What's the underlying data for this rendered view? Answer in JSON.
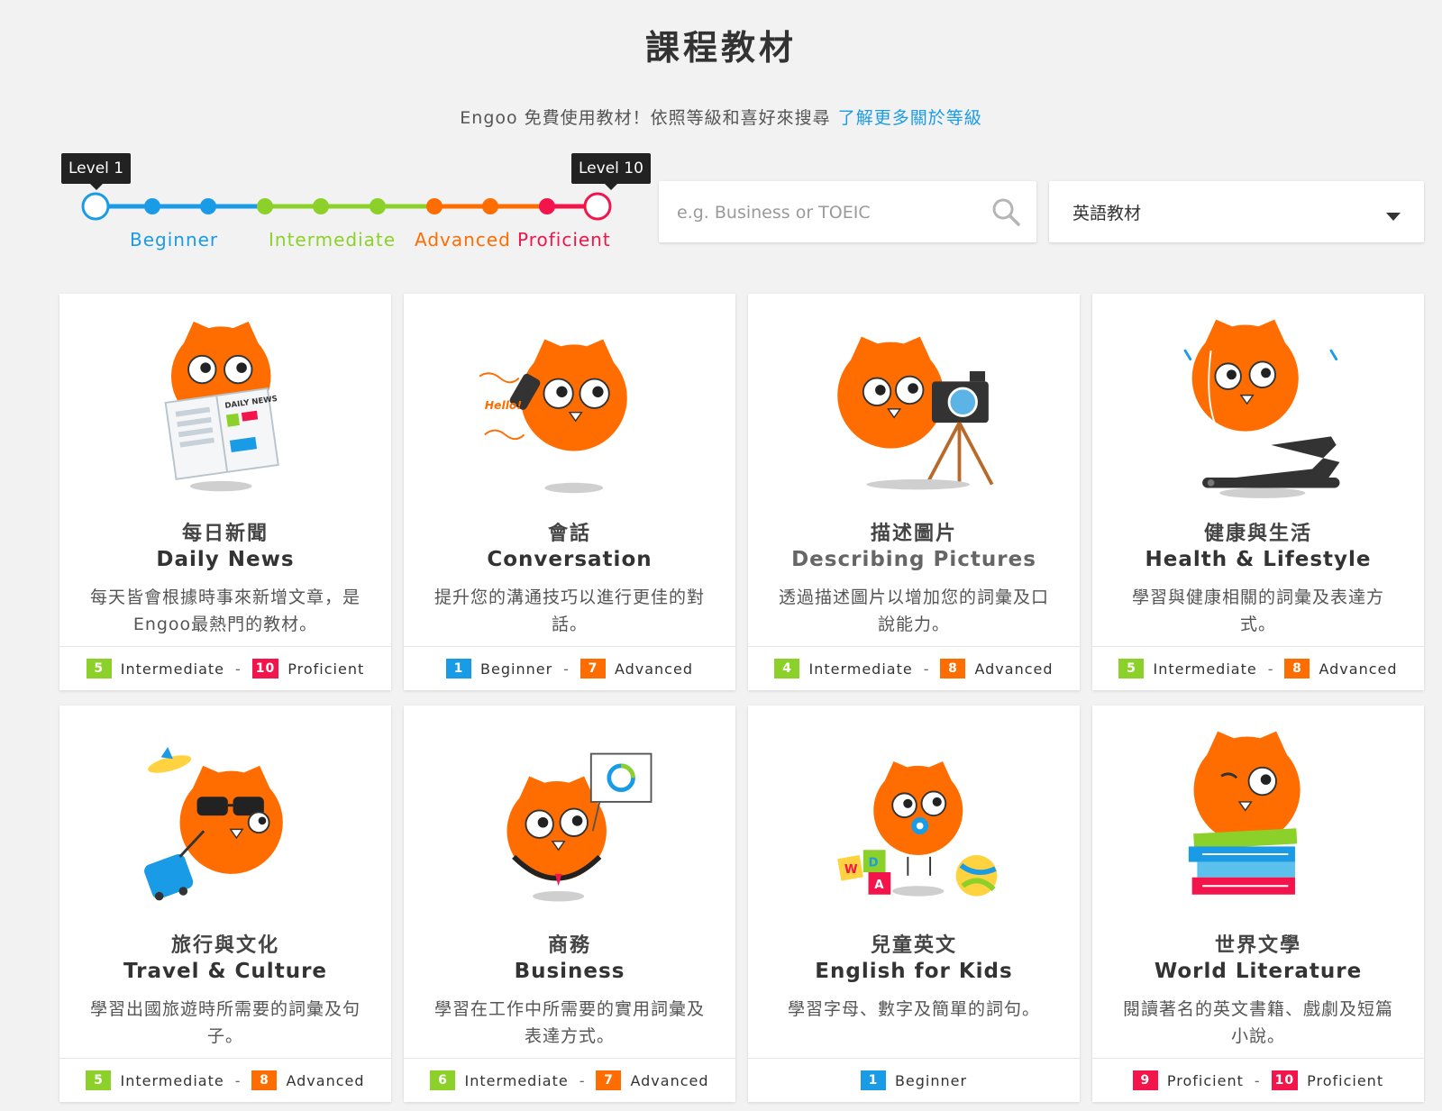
{
  "page": {
    "title": "課程教材",
    "subtitle": "Engoo 免費使用教材！依照等級和喜好來搜尋",
    "subtitle_link": "了解更多關於等級"
  },
  "level_slider": {
    "min_tooltip": "Level 1",
    "max_tooltip": "Level 10",
    "bands": [
      {
        "label": "Beginner",
        "color": "#1a9be6"
      },
      {
        "label": "Intermediate",
        "color": "#8cd12a"
      },
      {
        "label": "Advanced",
        "color": "#ff6d00"
      },
      {
        "label": "Proficient",
        "color": "#f2144a"
      }
    ],
    "selected_min": 1,
    "selected_max": 10
  },
  "search": {
    "placeholder": "e.g. Business or TOEIC",
    "value": ""
  },
  "language_select": {
    "selected": "英語教材"
  },
  "level_colors": {
    "Beginner": "#1a9be6",
    "Intermediate": "#8cd12a",
    "Advanced": "#ff6d00",
    "Proficient": "#f2144a"
  },
  "cards": [
    {
      "zh": "每日新聞",
      "en": "Daily News",
      "desc_lines": [
        "每天皆會根據時事來新增文章，是",
        "Engoo最熱門的教材。"
      ],
      "min_num": "5",
      "min_label": "Intermediate",
      "max_num": "10",
      "max_label": "Proficient",
      "icon": "owl-newspaper-icon",
      "newspaper_text": "DAILY NEWS"
    },
    {
      "zh": "會話",
      "en": "Conversation",
      "desc_lines": [
        "提升您的溝通技巧以進行更佳的對",
        "話。"
      ],
      "min_num": "1",
      "min_label": "Beginner",
      "max_num": "7",
      "max_label": "Advanced",
      "icon": "owl-phone-icon",
      "phone_text": "Hello!"
    },
    {
      "zh": "描述圖片",
      "en": "Describing Pictures",
      "desc_lines": [
        "透過描述圖片以增加您的詞彙及口",
        "說能力。"
      ],
      "min_num": "4",
      "min_label": "Intermediate",
      "max_num": "8",
      "max_label": "Advanced",
      "icon": "owl-camera-icon"
    },
    {
      "zh": "健康與生活",
      "en": "Health & Lifestyle",
      "desc_lines": [
        "學習與健康相關的詞彙及表達方",
        "式。"
      ],
      "min_num": "5",
      "min_label": "Intermediate",
      "max_num": "8",
      "max_label": "Advanced",
      "icon": "owl-treadmill-icon"
    },
    {
      "zh": "旅行與文化",
      "en": "Travel & Culture",
      "desc_lines": [
        "學習出國旅遊時所需要的詞彙及句",
        "子。"
      ],
      "min_num": "5",
      "min_label": "Intermediate",
      "max_num": "8",
      "max_label": "Advanced",
      "icon": "owl-suitcase-icon"
    },
    {
      "zh": "商務",
      "en": "Business",
      "desc_lines": [
        "學習在工作中所需要的實用詞彙及",
        "表達方式。"
      ],
      "min_num": "6",
      "min_label": "Intermediate",
      "max_num": "7",
      "max_label": "Advanced",
      "icon": "owl-presentation-icon"
    },
    {
      "zh": "兒童英文",
      "en": "English for Kids",
      "desc_lines": [
        "學習字母、數字及簡單的詞句。"
      ],
      "min_num": "1",
      "min_label": "Beginner",
      "max_num": "",
      "max_label": "",
      "icon": "owl-baby-icon",
      "blocks": [
        "W",
        "D",
        "A"
      ]
    },
    {
      "zh": "世界文學",
      "en": "World Literature",
      "desc_lines": [
        "閱讀著名的英文書籍、戲劇及短篇",
        "小說。"
      ],
      "min_num": "9",
      "min_label": "Proficient",
      "max_num": "10",
      "max_label": "Proficient",
      "icon": "owl-books-icon"
    }
  ]
}
